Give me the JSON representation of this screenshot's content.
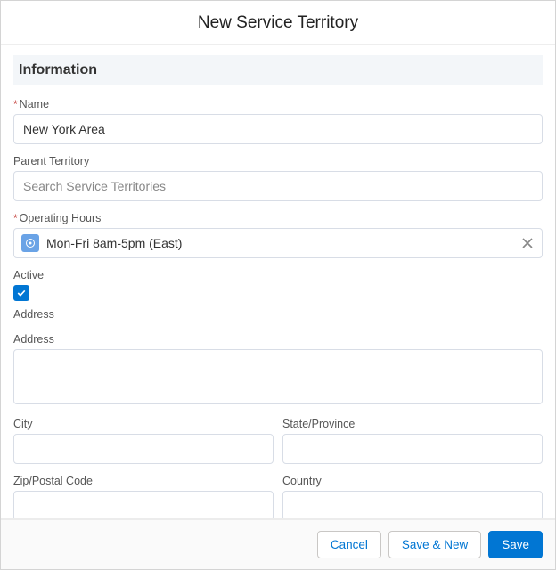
{
  "header": {
    "title": "New Service Territory"
  },
  "section": {
    "title": "Information"
  },
  "fields": {
    "name": {
      "label": "Name",
      "value": "New York Area",
      "required": true
    },
    "parent": {
      "label": "Parent Territory",
      "placeholder": "Search Service Territories",
      "value": ""
    },
    "hours": {
      "label": "Operating Hours",
      "required": true,
      "selected": "Mon-Fri 8am-5pm (East)"
    },
    "active": {
      "label": "Active",
      "checked": true
    },
    "addressSection": {
      "label": "Address"
    },
    "address": {
      "label": "Address",
      "value": ""
    },
    "city": {
      "label": "City",
      "value": ""
    },
    "state": {
      "label": "State/Province",
      "value": ""
    },
    "zip": {
      "label": "Zip/Postal Code",
      "value": ""
    },
    "country": {
      "label": "Country",
      "value": ""
    }
  },
  "footer": {
    "cancel": "Cancel",
    "saveNew": "Save & New",
    "save": "Save"
  },
  "requiredMark": "*"
}
